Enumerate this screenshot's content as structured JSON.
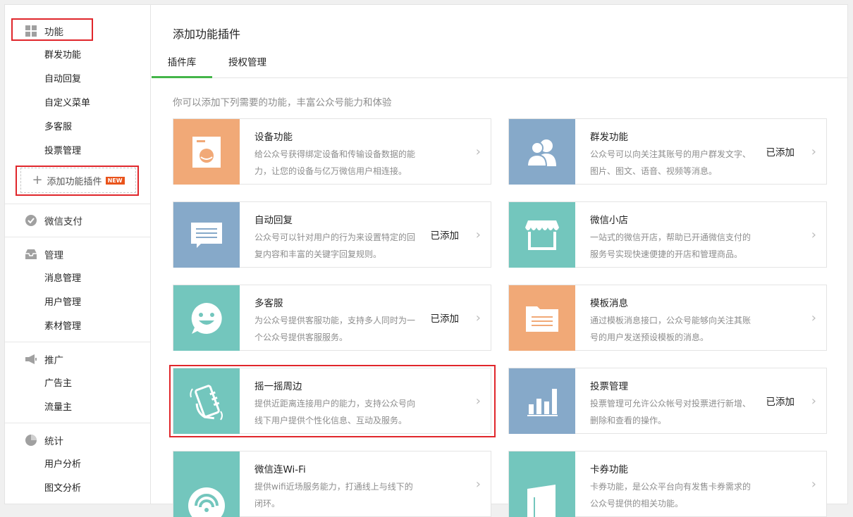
{
  "sidebar": {
    "groups": [
      {
        "label": "功能",
        "items": [
          "群发功能",
          "自动回复",
          "自定义菜单",
          "多客服",
          "投票管理"
        ]
      },
      {
        "label": "微信支付",
        "items": []
      },
      {
        "label": "管理",
        "items": [
          "消息管理",
          "用户管理",
          "素材管理"
        ]
      },
      {
        "label": "推广",
        "items": [
          "广告主",
          "流量主"
        ]
      },
      {
        "label": "统计",
        "items": [
          "用户分析",
          "图文分析"
        ]
      }
    ],
    "add_plugin": {
      "label": "添加功能插件",
      "badge": "NEW"
    }
  },
  "main": {
    "title": "添加功能插件",
    "tabs": [
      {
        "label": "插件库"
      },
      {
        "label": "授权管理"
      }
    ],
    "description": "你可以添加下列需要的功能，丰富公众号能力和体验",
    "cards": [
      {
        "title": "设备功能",
        "desc": "给公众号获得绑定设备和传输设备数据的能力，让您的设备与亿万微信用户相连接。",
        "status": "",
        "icon": "washing-machine-icon",
        "color": "#f1a977"
      },
      {
        "title": "群发功能",
        "desc": "公众号可以向关注其账号的用户群发文字、图片、图文、语音、视频等消息。",
        "status": "已添加",
        "icon": "users-icon",
        "color": "#86a9c9"
      },
      {
        "title": "自动回复",
        "desc": "公众号可以针对用户的行为来设置特定的回复内容和丰富的关键字回复规则。",
        "status": "已添加",
        "icon": "message-icon",
        "color": "#86a9c9"
      },
      {
        "title": "微信小店",
        "desc": "一站式的微信开店，帮助已开通微信支付的服务号实现快速便捷的开店和管理商品。",
        "status": "",
        "icon": "store-icon",
        "color": "#73c6bd"
      },
      {
        "title": "多客服",
        "desc": "为公众号提供客服功能，支持多人同时为一个公众号提供客服服务。",
        "status": "已添加",
        "icon": "smile-icon",
        "color": "#73c6bd"
      },
      {
        "title": "模板消息",
        "desc": "通过模板消息接口，公众号能够向关注其账号的用户发送预设模板的消息。",
        "status": "",
        "icon": "folder-icon",
        "color": "#f1a977"
      },
      {
        "title": "摇一摇周边",
        "desc": "提供近距离连接用户的能力，支持公众号向线下用户提供个性化信息、互动及服务。",
        "status": "",
        "icon": "shake-icon",
        "color": "#73c6bd"
      },
      {
        "title": "投票管理",
        "desc": "投票管理可允许公众帐号对投票进行新增、删除和查看的操作。",
        "status": "已添加",
        "icon": "bar-chart-icon",
        "color": "#86a9c9"
      },
      {
        "title": "微信连Wi-Fi",
        "desc": "提供wifi近场服务能力，打通线上与线下的闭环。",
        "status": "",
        "icon": "wifi-icon",
        "color": "#73c6bd"
      },
      {
        "title": "卡券功能",
        "desc": "卡券功能，是公众平台向有发售卡券需求的公众号提供的相关功能。",
        "status": "",
        "icon": "card-icon",
        "color": "#73c6bd"
      }
    ]
  }
}
